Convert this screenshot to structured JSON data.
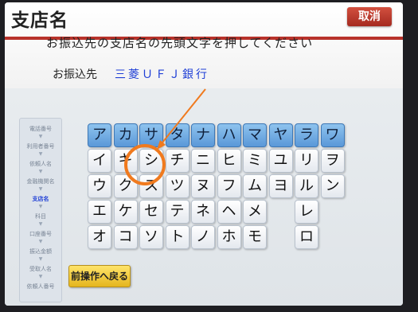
{
  "header": {
    "title": "支店名",
    "cancel_label": "取消",
    "instruction": "お振込先の支店名の先頭文字を押してください",
    "destination_label": "お振込先",
    "destination_value": "三菱ＵＦＪ銀行"
  },
  "steps": [
    "電話番号",
    "利用者番号",
    "依頼人名",
    "金融機関名",
    "支店名",
    "科目",
    "口座番号",
    "振込金額",
    "受取人名",
    "依頼人番号"
  ],
  "active_step": "支店名",
  "keyboard": {
    "row1": [
      "ア",
      "カ",
      "サ",
      "タ",
      "ナ",
      "ハ",
      "マ",
      "ヤ",
      "ラ",
      "ワ"
    ],
    "row2": [
      "イ",
      "キ",
      "シ",
      "チ",
      "ニ",
      "ヒ",
      "ミ",
      "ユ",
      "リ",
      "ヲ"
    ],
    "row3": [
      "ウ",
      "ク",
      "ス",
      "ツ",
      "ヌ",
      "フ",
      "ム",
      "ヨ",
      "ル",
      "ン"
    ],
    "row4": [
      "エ",
      "ケ",
      "セ",
      "テ",
      "ネ",
      "ヘ",
      "メ",
      "レ"
    ],
    "row5": [
      "オ",
      "コ",
      "ソ",
      "ト",
      "ノ",
      "ホ",
      "モ",
      "ロ"
    ]
  },
  "footer": {
    "back_label": "前操作へ戻る"
  },
  "colors": {
    "accent_red": "#b8322a",
    "key_blue": "#5a98d8",
    "annotation_orange": "#f07a1e",
    "destination_blue": "#1f3fd6"
  }
}
